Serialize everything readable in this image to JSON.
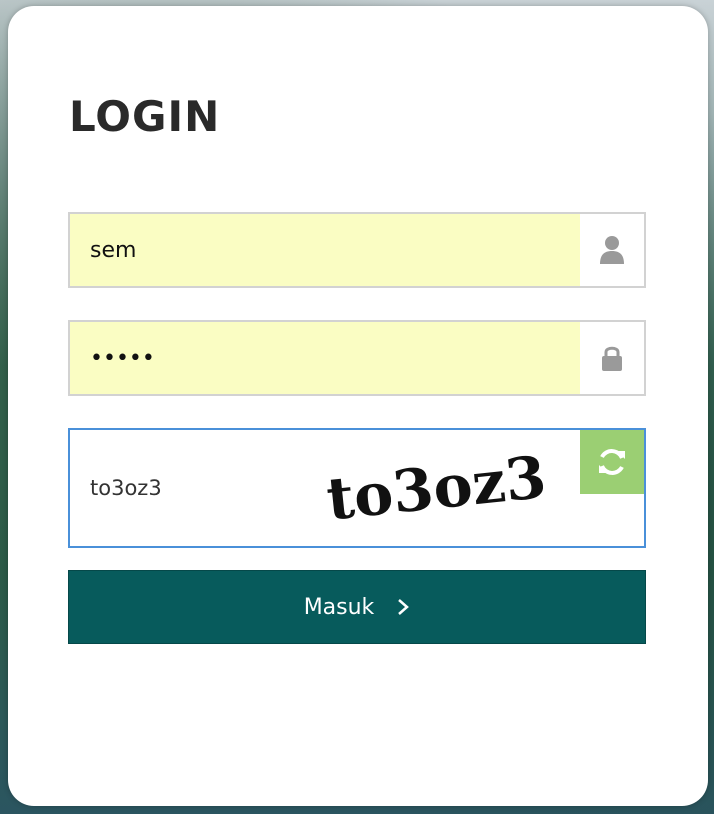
{
  "login": {
    "title": "LOGIN",
    "username": {
      "value": "sem",
      "icon": "user-icon"
    },
    "password": {
      "value": "•••••",
      "icon": "lock-icon"
    },
    "captcha": {
      "input_value": "to3oz3",
      "image_text": "to3oz3",
      "refresh_icon": "refresh-icon"
    },
    "submit_label": "Masuk",
    "submit_icon": "chevron-right-icon"
  },
  "colors": {
    "autofill": "#fafdc3",
    "submit": "#075b5c",
    "refresh": "#9bcf73",
    "captcha_border": "#4a90d9",
    "icon": "#9a9a9a"
  }
}
